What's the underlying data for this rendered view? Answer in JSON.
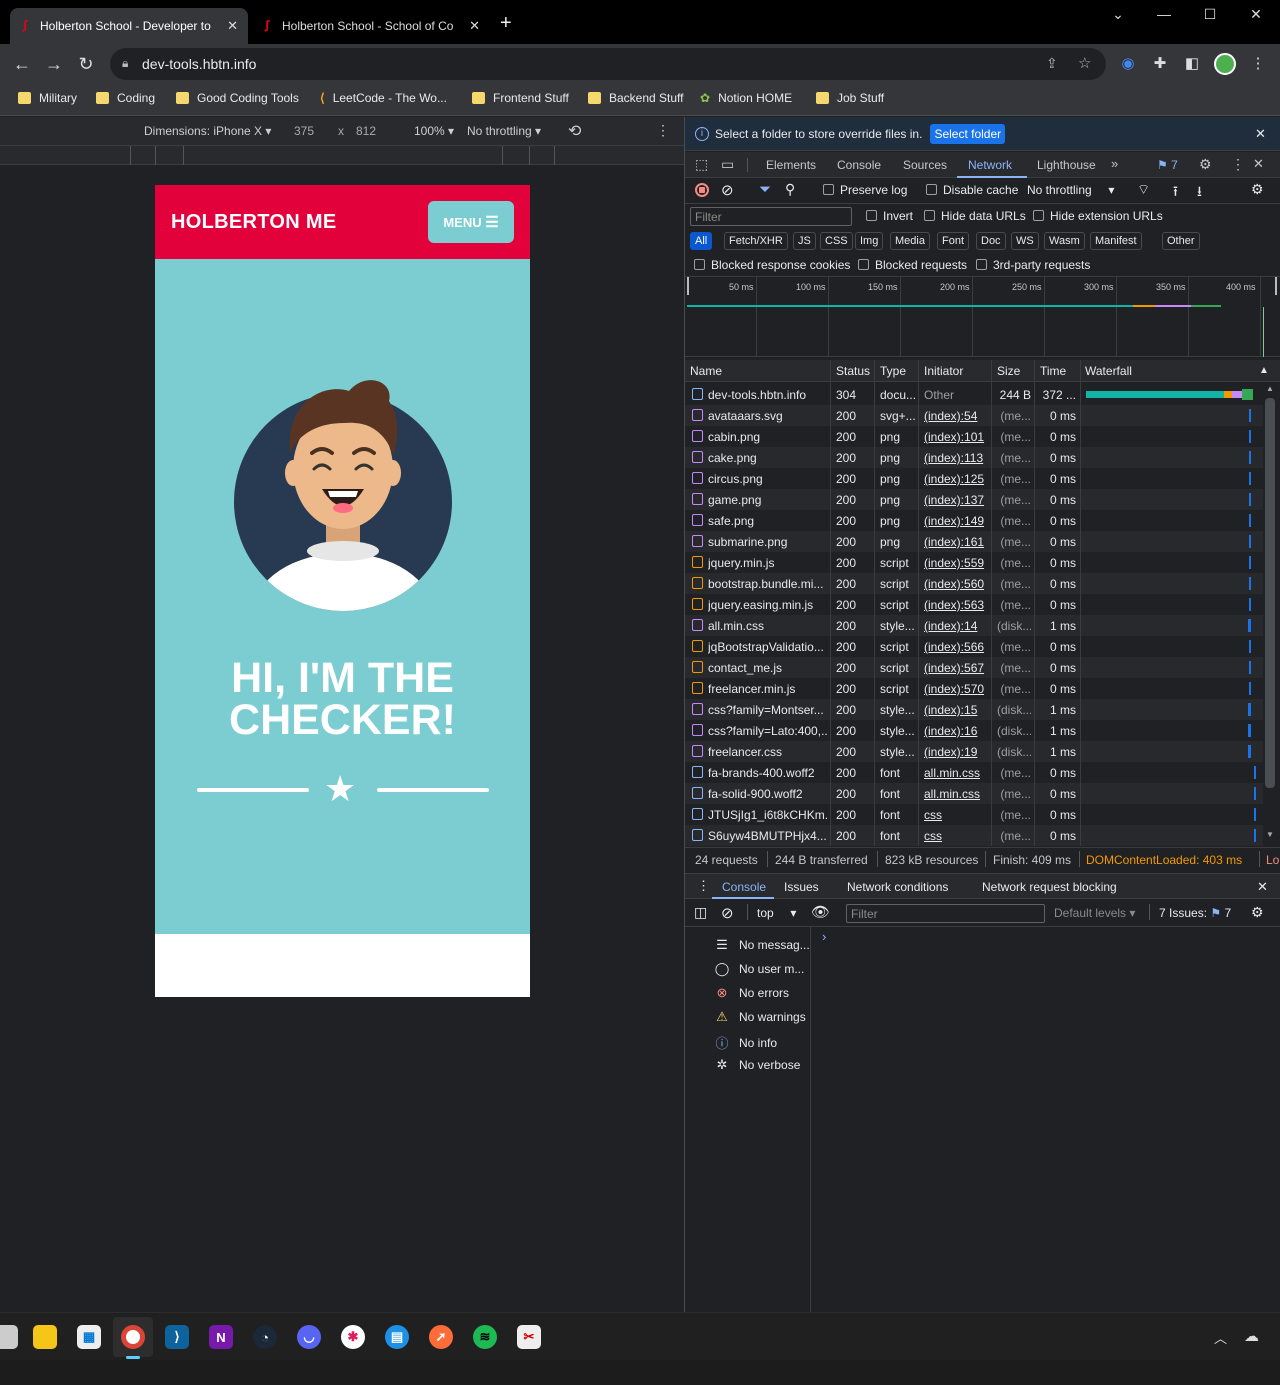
{
  "browser": {
    "tabs": [
      {
        "label": "Holberton School - Developer to",
        "active": true
      },
      {
        "label": "Holberton School - School of Co",
        "active": false
      }
    ],
    "new_tab": "+",
    "window_controls": {
      "minimize": "—",
      "maximize": "☐",
      "close": "✕",
      "tab_search": "⌄"
    },
    "url": "dev-tools.hbtn.info",
    "bookmarks": [
      {
        "label": "Military",
        "icon": "folder-icon"
      },
      {
        "label": "Coding",
        "icon": "folder-icon"
      },
      {
        "label": "Good Coding Tools",
        "icon": "folder-icon"
      },
      {
        "label": "LeetCode - The Wo...",
        "icon": "leetcode-icon"
      },
      {
        "label": "Frontend Stuff",
        "icon": "folder-icon"
      },
      {
        "label": "Backend Stuff",
        "icon": "folder-icon"
      },
      {
        "label": "Notion HOME",
        "icon": "notion-icon"
      },
      {
        "label": "Job Stuff",
        "icon": "folder-icon"
      }
    ]
  },
  "device_toolbar": {
    "dimensions": "Dimensions: iPhone X",
    "width": "375",
    "x": "x",
    "height": "812",
    "zoom": "100%",
    "throttling": "No throttling"
  },
  "page": {
    "brand": "HOLBERTON ME",
    "menu": "MENU",
    "title_line1": "HI, I'M THE",
    "title_line2": "CHECKER!",
    "colors": {
      "nav": "#e2013b",
      "hero": "#7bcdd2"
    }
  },
  "devtools": {
    "infobar": {
      "text": "Select a folder to store override files in.",
      "button": "Select folder"
    },
    "tabs": [
      "Elements",
      "Console",
      "Sources",
      "Network",
      "Lighthouse"
    ],
    "active_tab": "Network",
    "issues_count": "7",
    "toolbar": {
      "preserve_log": "Preserve log",
      "disable_cache": "Disable cache",
      "throttling": "No throttling"
    },
    "filter": {
      "placeholder": "Filter",
      "invert": "Invert",
      "hide_data_urls": "Hide data URLs",
      "hide_extension_urls": "Hide extension URLs"
    },
    "type_filters": [
      "All",
      "Fetch/XHR",
      "JS",
      "CSS",
      "Img",
      "Media",
      "Font",
      "Doc",
      "WS",
      "Wasm",
      "Manifest",
      "Other"
    ],
    "checks": {
      "blocked_cookies": "Blocked response cookies",
      "blocked_requests": "Blocked requests",
      "third_party": "3rd-party requests"
    },
    "overview_ticks": [
      "50 ms",
      "100 ms",
      "150 ms",
      "200 ms",
      "250 ms",
      "300 ms",
      "350 ms",
      "400 ms"
    ],
    "columns": [
      "Name",
      "Status",
      "Type",
      "Initiator",
      "Size",
      "Time",
      "Waterfall"
    ],
    "requests": [
      {
        "name": "dev-tools.hbtn.info",
        "status": "304",
        "type": "docu...",
        "initiator": "Other",
        "size": "244 B",
        "time": "372 ...",
        "icon": "document-icon"
      },
      {
        "name": "avataaars.svg",
        "status": "200",
        "type": "svg+...",
        "initiator": "(index):54",
        "size": "(me...",
        "time": "0 ms",
        "icon": "image-icon"
      },
      {
        "name": "cabin.png",
        "status": "200",
        "type": "png",
        "initiator": "(index):101",
        "size": "(me...",
        "time": "0 ms",
        "icon": "image-icon"
      },
      {
        "name": "cake.png",
        "status": "200",
        "type": "png",
        "initiator": "(index):113",
        "size": "(me...",
        "time": "0 ms",
        "icon": "image-icon"
      },
      {
        "name": "circus.png",
        "status": "200",
        "type": "png",
        "initiator": "(index):125",
        "size": "(me...",
        "time": "0 ms",
        "icon": "image-icon"
      },
      {
        "name": "game.png",
        "status": "200",
        "type": "png",
        "initiator": "(index):137",
        "size": "(me...",
        "time": "0 ms",
        "icon": "image-icon"
      },
      {
        "name": "safe.png",
        "status": "200",
        "type": "png",
        "initiator": "(index):149",
        "size": "(me...",
        "time": "0 ms",
        "icon": "image-icon"
      },
      {
        "name": "submarine.png",
        "status": "200",
        "type": "png",
        "initiator": "(index):161",
        "size": "(me...",
        "time": "0 ms",
        "icon": "image-icon"
      },
      {
        "name": "jquery.min.js",
        "status": "200",
        "type": "script",
        "initiator": "(index):559",
        "size": "(me...",
        "time": "0 ms",
        "icon": "script-icon"
      },
      {
        "name": "bootstrap.bundle.mi...",
        "status": "200",
        "type": "script",
        "initiator": "(index):560",
        "size": "(me...",
        "time": "0 ms",
        "icon": "script-icon"
      },
      {
        "name": "jquery.easing.min.js",
        "status": "200",
        "type": "script",
        "initiator": "(index):563",
        "size": "(me...",
        "time": "0 ms",
        "icon": "script-icon"
      },
      {
        "name": "all.min.css",
        "status": "200",
        "type": "style...",
        "initiator": "(index):14",
        "size": "(disk...",
        "time": "1 ms",
        "icon": "stylesheet-icon"
      },
      {
        "name": "jqBootstrapValidatio...",
        "status": "200",
        "type": "script",
        "initiator": "(index):566",
        "size": "(me...",
        "time": "0 ms",
        "icon": "script-icon"
      },
      {
        "name": "contact_me.js",
        "status": "200",
        "type": "script",
        "initiator": "(index):567",
        "size": "(me...",
        "time": "0 ms",
        "icon": "script-icon"
      },
      {
        "name": "freelancer.min.js",
        "status": "200",
        "type": "script",
        "initiator": "(index):570",
        "size": "(me...",
        "time": "0 ms",
        "icon": "script-icon"
      },
      {
        "name": "css?family=Montser...",
        "status": "200",
        "type": "style...",
        "initiator": "(index):15",
        "size": "(disk...",
        "time": "1 ms",
        "icon": "stylesheet-icon"
      },
      {
        "name": "css?family=Lato:400,...",
        "status": "200",
        "type": "style...",
        "initiator": "(index):16",
        "size": "(disk...",
        "time": "1 ms",
        "icon": "stylesheet-icon"
      },
      {
        "name": "freelancer.css",
        "status": "200",
        "type": "style...",
        "initiator": "(index):19",
        "size": "(disk...",
        "time": "1 ms",
        "icon": "stylesheet-icon"
      },
      {
        "name": "fa-brands-400.woff2",
        "status": "200",
        "type": "font",
        "initiator": "all.min.css",
        "size": "(me...",
        "time": "0 ms",
        "icon": "font-icon"
      },
      {
        "name": "fa-solid-900.woff2",
        "status": "200",
        "type": "font",
        "initiator": "all.min.css",
        "size": "(me...",
        "time": "0 ms",
        "icon": "font-icon"
      },
      {
        "name": "JTUSjIg1_i6t8kCHKm...",
        "status": "200",
        "type": "font",
        "initiator": "css",
        "size": "(me...",
        "time": "0 ms",
        "icon": "font-icon"
      },
      {
        "name": "S6uyw4BMUTPHjx4...",
        "status": "200",
        "type": "font",
        "initiator": "css",
        "size": "(me...",
        "time": "0 ms",
        "icon": "font-icon"
      }
    ],
    "summary": {
      "requests": "24 requests",
      "transferred": "244 B transferred",
      "resources": "823 kB resources",
      "finish": "Finish: 409 ms",
      "dcl": "DOMContentLoaded: 403 ms",
      "load": "Lo"
    },
    "drawer": {
      "tabs": [
        "Console",
        "Issues",
        "Network conditions",
        "Network request blocking"
      ],
      "context": "top",
      "filter_placeholder": "Filter",
      "levels": "Default levels",
      "issues": "7 Issues:",
      "issues_count": "7",
      "sidebar": [
        {
          "label": "No messag...",
          "icon": "list-icon"
        },
        {
          "label": "No user m...",
          "icon": "user-icon"
        },
        {
          "label": "No errors",
          "icon": "error-icon"
        },
        {
          "label": "No warnings",
          "icon": "warning-icon"
        },
        {
          "label": "No info",
          "icon": "info-icon"
        },
        {
          "label": "No verbose",
          "icon": "bug-icon"
        }
      ],
      "prompt": "›"
    }
  }
}
